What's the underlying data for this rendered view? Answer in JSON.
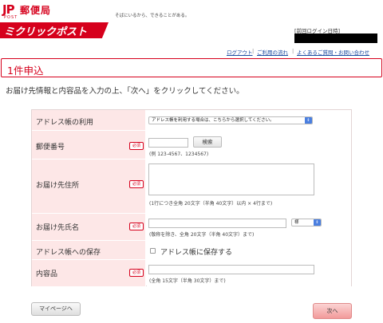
{
  "header": {
    "jp_mark": "JP",
    "jp_post": "POST",
    "jp_name": "郵便局",
    "slogan": "そばにいるから、できることがある。",
    "brand": "ミクリックポスト",
    "login_label": "[前回ログイン日時]",
    "brand_color": "#d6001c"
  },
  "utilnav": {
    "logout": "ログアウト",
    "usage": "ご利用の流れ",
    "faq": "よくあるご質問・お問い合わせ",
    "separator": "|"
  },
  "page": {
    "title": "1件申込",
    "instruction": "お届け先情報と内容品を入力の上、「次へ」をクリックしてください。"
  },
  "form": {
    "required_badge": "必須",
    "address_book": {
      "label": "アドレス帳の利用",
      "select_value": "アドレス帳を利用する場合は、こちらから選択してください。"
    },
    "postal_code": {
      "label": "郵便番号",
      "search_button": "検索",
      "hint": "(例 123-4567、1234567)"
    },
    "address": {
      "label": "お届け先住所",
      "hint": "(1行につき全角 20文字（半角 40文字）以内 × 4行まで)"
    },
    "name": {
      "label": "お届け先氏名",
      "honorific": "様",
      "hint": "(敬称を除き、全角 20文字（半角 40文字）まで)"
    },
    "save_address": {
      "label": "アドレス帳への保存",
      "checkbox_label": "アドレス帳に保存する"
    },
    "contents": {
      "label": "内容品",
      "hint": "(全角 15文字（半角 30文字）まで)"
    }
  },
  "buttons": {
    "mypage": "マイページへ",
    "next": "次へ"
  }
}
